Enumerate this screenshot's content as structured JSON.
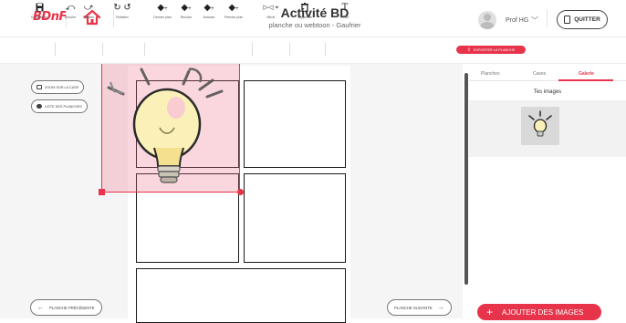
{
  "header": {
    "logo": "BDnF",
    "title": "Activité BD",
    "subtitle": "planche ou webtoon - Gaufrier",
    "user_name": "Prof HG",
    "quit_label": "QUITTER"
  },
  "toolbar": {
    "save": "Enregistrer",
    "undo": "Annuler",
    "redo": "Rétablir",
    "rotation": "Rotation",
    "send_back": "Dernier plan",
    "move_back": "Reculer",
    "move_forward": "Avancer",
    "bring_front": "Premier plan",
    "mirror": "Miroir",
    "delete": "Supprimer",
    "text": "Texte",
    "export_label": "EXPORTER LA PLANCHE"
  },
  "canvas": {
    "zoom_label": "ZOOM SUR LA CASE",
    "list_label": "LISTE DES PLANCHES",
    "prev_label": "PLANCHE PRÉCÉDENTE",
    "next_label": "PLANCHE SUIVANTE"
  },
  "panel": {
    "tabs": [
      "Planches",
      "Cases",
      "Galerie"
    ],
    "active_tab": "Galerie",
    "heading": "Tes images",
    "add_label": "AJOUTER DES IMAGES"
  },
  "colors": {
    "accent": "#e8344a"
  }
}
